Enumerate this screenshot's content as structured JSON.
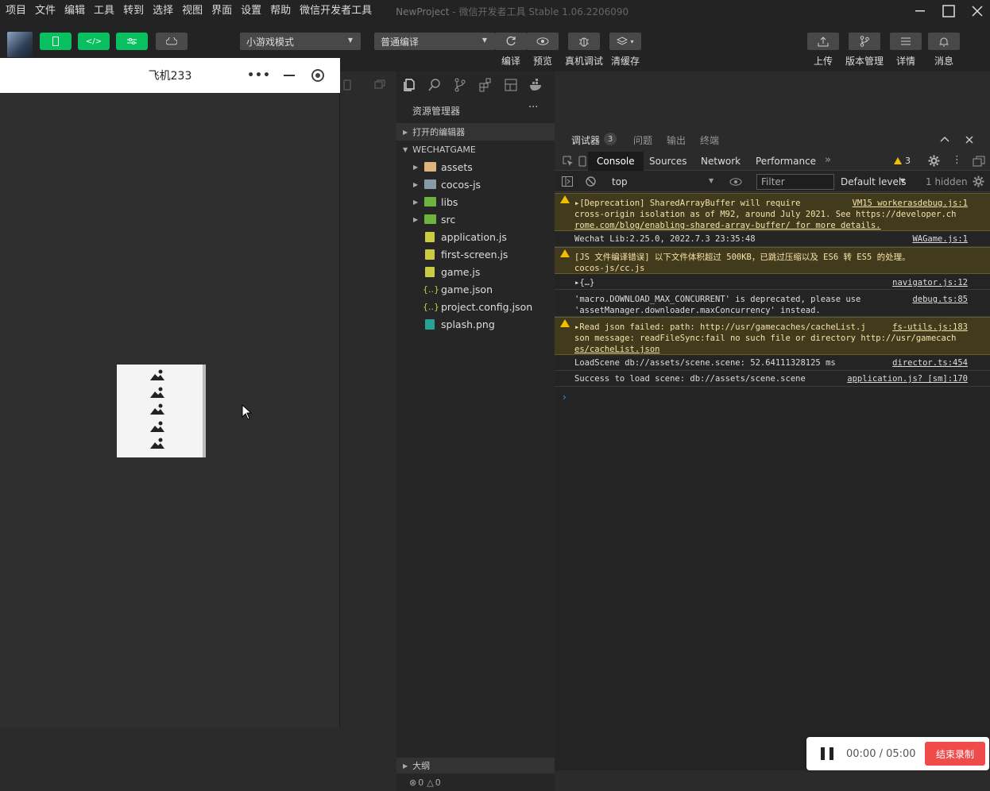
{
  "menubar": {
    "items": [
      "项目",
      "文件",
      "编辑",
      "工具",
      "转到",
      "选择",
      "视图",
      "界面",
      "设置",
      "帮助",
      "微信开发者工具"
    ],
    "title": "NewProject",
    "subtitle": "- 微信开发者工具 Stable 1.06.2206090"
  },
  "toolbar": {
    "compile_mode": "小游戏模式",
    "compile_type": "普通编译",
    "compile": "编译",
    "preview": "预览",
    "real_debug": "真机调试",
    "clear_cache": "清缓存",
    "upload": "上传",
    "version": "版本管理",
    "details": "详情",
    "messages": "消息"
  },
  "simulator": {
    "title": "飞机233",
    "more": "•••"
  },
  "explorer": {
    "header": "资源管理器",
    "more": "···",
    "open_editors": "打开的编辑器",
    "project": "WECHATGAME",
    "items": [
      {
        "label": "assets",
        "type": "folder"
      },
      {
        "label": "cocos-js",
        "type": "folder"
      },
      {
        "label": "libs",
        "type": "folder"
      },
      {
        "label": "src",
        "type": "folder"
      },
      {
        "label": "application.js",
        "type": "js"
      },
      {
        "label": "first-screen.js",
        "type": "js"
      },
      {
        "label": "game.js",
        "type": "js"
      },
      {
        "label": "game.json",
        "type": "json"
      },
      {
        "label": "project.config.json",
        "type": "json"
      },
      {
        "label": "splash.png",
        "type": "png"
      }
    ],
    "outline": "大纲",
    "status_errors": "0",
    "status_warnings": "0"
  },
  "debugger": {
    "tabs": [
      "调试器",
      "问题",
      "输出",
      "终端"
    ],
    "badge": "3",
    "devtools_tabs": [
      "Console",
      "Sources",
      "Network",
      "Performance"
    ],
    "warn_count": "3",
    "context": "top",
    "filter_placeholder": "Filter",
    "levels": "Default levels",
    "hidden": "1 hidden"
  },
  "console": {
    "logs": [
      {
        "level": "warn",
        "lines": [
          "▸[Deprecation] SharedArrayBuffer will require",
          "cross-origin isolation as of M92, around July 2021. See https://developer.ch",
          "rome.com/blog/enabling-shared-array-buffer/ for more details."
        ],
        "source": "VM15 workerasdebug.js:1"
      },
      {
        "level": "info",
        "lines": [
          "Wechat Lib:2.25.0, 2022.7.3 23:35:48"
        ],
        "source": "WAGame.js:1"
      },
      {
        "level": "warn",
        "lines": [
          "[JS 文件编译错误] 以下文件体积超过 500KB，已跳过压缩以及 ES6 转 ES5 的处理。",
          "cocos-js/cc.js"
        ],
        "source": ""
      },
      {
        "level": "info",
        "lines": [
          "▸{…}"
        ],
        "source": "navigator.js:12"
      },
      {
        "level": "info",
        "lines": [
          "'macro.DOWNLOAD_MAX_CONCURRENT' is deprecated, please use",
          "'assetManager.downloader.maxConcurrency' instead."
        ],
        "source": "debug.ts:85"
      },
      {
        "level": "warn",
        "lines": [
          "▸Read json failed: path: http://usr/gamecaches/cacheList.j",
          "son message: readFileSync:fail no such file or directory http://usr/gamecach",
          "es/cacheList.json"
        ],
        "source": "fs-utils.js:183"
      },
      {
        "level": "info",
        "lines": [
          "LoadScene db://assets/scene.scene: 52.64111328125 ms"
        ],
        "source": "director.ts:454"
      },
      {
        "level": "info",
        "lines": [
          "Success to load scene: db://assets/scene.scene"
        ],
        "source": "application.js? [sm]:170"
      }
    ],
    "prompt": "›"
  },
  "recorder": {
    "time": "00:00 / 05:00",
    "stop": "结束录制"
  }
}
